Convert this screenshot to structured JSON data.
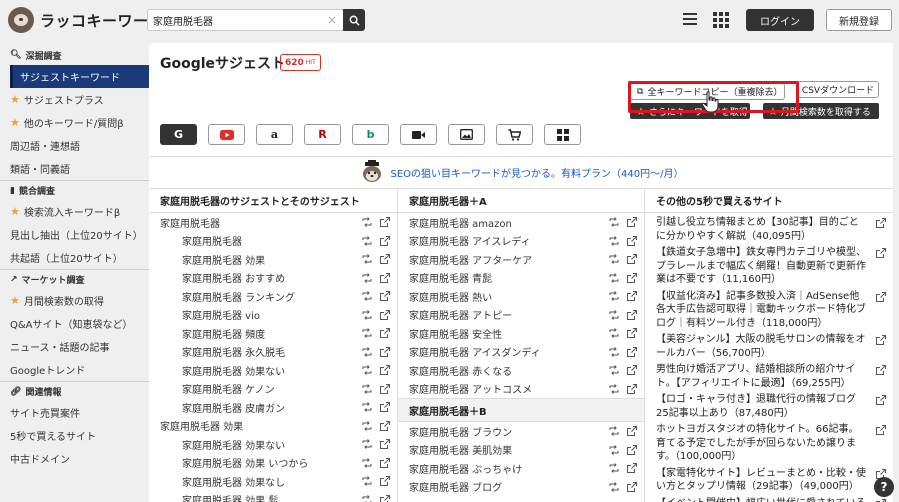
{
  "header": {
    "logo_text": "ラッコキーワード",
    "search_value": "家庭用脱毛器",
    "clear_glyph": "×",
    "login": "ログイン",
    "signup": "新規登録"
  },
  "sidebar": {
    "sections": [
      {
        "title": "深掘調査",
        "items": [
          {
            "label": "サジェストキーワード",
            "active": true,
            "star": false
          },
          {
            "label": "サジェストプラス",
            "star": true
          },
          {
            "label": "他のキーワード/質問β",
            "star": true
          },
          {
            "label": "周辺語・連想語",
            "star": false
          },
          {
            "label": "類語・同義語",
            "star": false
          }
        ]
      },
      {
        "title": "競合調査",
        "items": [
          {
            "label": "検索流入キーワードβ",
            "star": true
          },
          {
            "label": "見出し抽出（上位20サイト）",
            "star": false
          },
          {
            "label": "共起語（上位20サイト）",
            "star": false
          }
        ]
      },
      {
        "title": "マーケット調査",
        "items": [
          {
            "label": "月間検索数の取得",
            "star": true
          },
          {
            "label": "Q&Aサイト（知恵袋など）",
            "star": false
          },
          {
            "label": "ニュース・話題の記事",
            "star": false
          },
          {
            "label": "Googleトレンド",
            "star": false
          }
        ]
      },
      {
        "title": "関連情報",
        "items": [
          {
            "label": "サイト売買案件",
            "star": false
          },
          {
            "label": "5秒で買えるサイト",
            "star": false
          },
          {
            "label": "中古ドメイン",
            "star": false
          }
        ]
      }
    ]
  },
  "main": {
    "title": "Googleサジェスト",
    "hit_count": "620",
    "hit_unit": "HIT",
    "copy_btn": "全キーワードコピー（重複除去）",
    "csv_btn": "CSVダウンロード",
    "dark_btn1": "さらにキーワードを取得",
    "dark_btn2": "月間検索数を取得する",
    "engines": [
      "G",
      "▶",
      "a",
      "R",
      "b",
      "■",
      "▣",
      "🛒",
      "▦"
    ],
    "promo": "SEOの狙い目キーワードが見つかる。有料プラン（440円〜/月）"
  },
  "col1": {
    "heading": "家庭用脱毛器のサジェストとそのサジェスト",
    "rows": [
      {
        "t": "家庭用脱毛器",
        "child": false
      },
      {
        "t": "家庭用脱毛器",
        "child": true
      },
      {
        "t": "家庭用脱毛器 効果",
        "child": true
      },
      {
        "t": "家庭用脱毛器 おすすめ",
        "child": true
      },
      {
        "t": "家庭用脱毛器 ランキング",
        "child": true
      },
      {
        "t": "家庭用脱毛器 vio",
        "child": true
      },
      {
        "t": "家庭用脱毛器 頻度",
        "child": true
      },
      {
        "t": "家庭用脱毛器 永久脱毛",
        "child": true
      },
      {
        "t": "家庭用脱毛器 効果ない",
        "child": true
      },
      {
        "t": "家庭用脱毛器 ケノン",
        "child": true
      },
      {
        "t": "家庭用脱毛器 皮膚ガン",
        "child": true
      },
      {
        "t": "家庭用脱毛器 効果",
        "child": false
      },
      {
        "t": "家庭用脱毛器 効果ない",
        "child": true
      },
      {
        "t": "家庭用脱毛器 効果 いつから",
        "child": true
      },
      {
        "t": "家庭用脱毛器 効果なし",
        "child": true
      },
      {
        "t": "家庭用脱毛器 効果 髭",
        "child": true
      }
    ]
  },
  "col2": {
    "heading": "家庭用脱毛器＋A",
    "rows_a": [
      "家庭用脱毛器 amazon",
      "家庭用脱毛器 アイスレディ",
      "家庭用脱毛器 アフターケア",
      "家庭用脱毛器 青髭",
      "家庭用脱毛器 熱い",
      "家庭用脱毛器 アトピー",
      "家庭用脱毛器 安全性",
      "家庭用脱毛器 アイスダンディ",
      "家庭用脱毛器 赤くなる",
      "家庭用脱毛器 アットコスメ"
    ],
    "heading_b": "家庭用脱毛器＋B",
    "rows_b": [
      "家庭用脱毛器 ブラウン",
      "家庭用脱毛器 美肌効果",
      "家庭用脱毛器 ぶっちゃけ",
      "家庭用脱毛器 ブログ"
    ]
  },
  "col3": {
    "heading": "その他の5秒で買えるサイト",
    "sites": [
      "引越し役立ち情報まとめ【30記事】目的ごとに分かりやすく解説（40,095円）",
      "【鉄道女子急増中】鉄女専門カテゴリや模型、プラレールまで幅広く網羅！自動更新で更新作業は不要です（11,160円）",
      "【収益化済み】記事多数投入済｜AdSense他各大手広告認可取得｜電動キックボード特化ブログ｜有料ツール付き（118,000円）",
      "【美容ジャンル】大阪の脱毛サロンの情報をオールカバー（56,700円）",
      "男性向け婚活アプリ、結婚相談所の紹介サイト。【アフィリエイトに最適】（69,255円）",
      "【ロゴ・キャラ付き】退職代行の情報ブログ25記事以上あり（87,480円）",
      "ホットヨガスタジオの特化サイト。66記事。育てる予定でしたが手が回らないため譲ります。（100,000円）",
      "【家電特化サイト】レビューまとめ・比較・使い方とタップリ情報（29記事）（49,000円）",
      "【イベント開催中】幅広い世代に愛されているドラマ"
    ]
  },
  "help": "?"
}
